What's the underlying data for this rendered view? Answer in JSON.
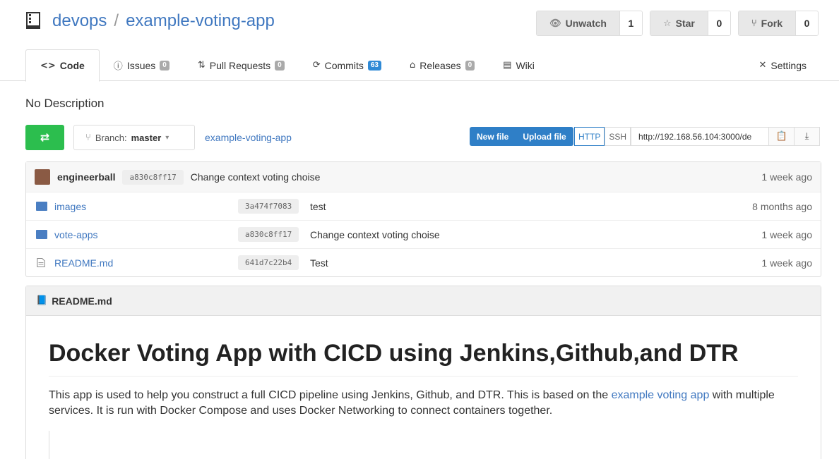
{
  "repo": {
    "owner": "devops",
    "separator": "/",
    "name": "example-voting-app"
  },
  "actions": {
    "watch": {
      "label": "Unwatch",
      "count": "1",
      "icon": "eye-icon"
    },
    "star": {
      "label": "Star",
      "count": "0",
      "icon": "star-icon"
    },
    "fork": {
      "label": "Fork",
      "count": "0",
      "icon": "fork-icon"
    }
  },
  "tabs": [
    {
      "label": "Code",
      "icon": "code-icon"
    },
    {
      "label": "Issues",
      "badge": "0",
      "icon": "issue-icon"
    },
    {
      "label": "Pull Requests",
      "badge": "0",
      "icon": "pull-request-icon"
    },
    {
      "label": "Commits",
      "badge": "63",
      "icon": "history-icon"
    },
    {
      "label": "Releases",
      "badge": "0",
      "icon": "tag-icon"
    },
    {
      "label": "Wiki",
      "icon": "book-icon"
    },
    {
      "label": "Settings",
      "icon": "tools-icon"
    }
  ],
  "description": "No Description",
  "toolbar": {
    "branch_prefix": "Branch:",
    "branch": "master",
    "breadcrumb": "example-voting-app",
    "new_file": "New file",
    "upload_file": "Upload file",
    "http": "HTTP",
    "ssh": "SSH",
    "clone_url": "http://192.168.56.104:3000/de"
  },
  "latest_commit": {
    "author": "engineerball",
    "sha": "a830c8ff17",
    "message": "Change context voting choise",
    "when": "1 week ago"
  },
  "files": [
    {
      "name": "images",
      "type": "folder",
      "sha": "3a474f7083",
      "message": "test",
      "when": "8 months ago"
    },
    {
      "name": "vote-apps",
      "type": "folder",
      "sha": "a830c8ff17",
      "message": "Change context voting choise",
      "when": "1 week ago"
    },
    {
      "name": "README.md",
      "type": "file",
      "sha": "641d7c22b4",
      "message": "Test",
      "when": "1 week ago"
    }
  ],
  "readme": {
    "filename": "README.md",
    "heading": "Docker Voting App with CICD using Jenkins,Github,and DTR",
    "para_before": "This app is used to help you construct a full CICD pipeline using Jenkins, Github, and DTR. This is based on the ",
    "link": "example voting app",
    "para_after": " with multiple services. It is run with Docker Compose and uses Docker Networking to connect containers together."
  }
}
